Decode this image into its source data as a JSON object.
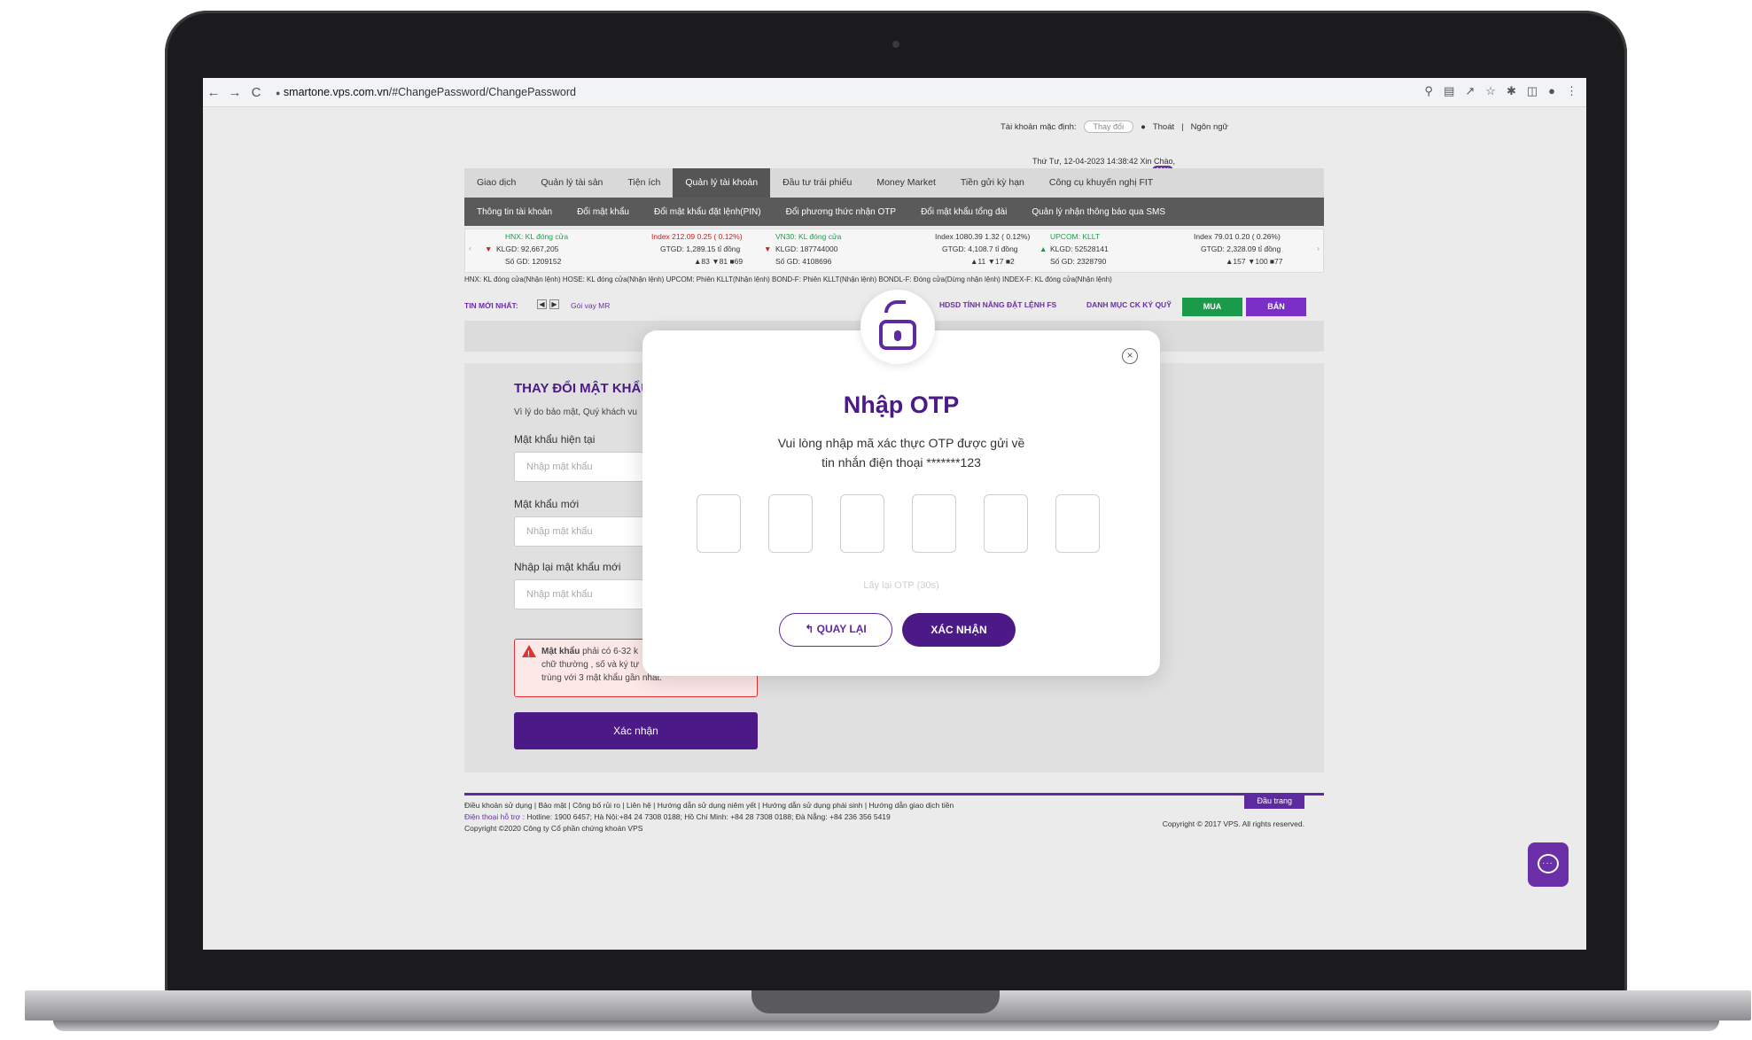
{
  "browser": {
    "url_host": "smartone.vps.com.vn",
    "url_path": "/#ChangePassword/ChangePassword",
    "back": "←",
    "forward": "→",
    "reload": "C",
    "lock": "🔒"
  },
  "header": {
    "default_account_label": "Tài khoản mặc định:",
    "change_label": "Thay đổi",
    "logout": "Thoát",
    "language": "Ngôn ngữ",
    "datetime": "Thứ Tư, 12-04-2023 14:38:42",
    "greeting": "Xin Chào,",
    "new_badge": "Mới"
  },
  "main_nav": [
    "Giao dịch",
    "Quản lý tài sản",
    "Tiện ích",
    "Quản lý tài khoản",
    "Đầu tư trái phiếu",
    "Money Market",
    "Tiền gửi kỳ hạn",
    "Công cụ khuyến nghị FIT"
  ],
  "main_nav_active": "Quản lý tài khoản",
  "sub_nav": [
    "Thông tin tài khoản",
    "Đổi mật khẩu",
    "Đổi mật khẩu đặt lệnh(PIN)",
    "Đổi phương thức nhận OTP",
    "Đổi mật khẩu tổng đài",
    "Quản lý nhận thông báo qua SMS"
  ],
  "ticker": {
    "hnx_title": "HNX: KL đóng cửa",
    "hnx_index": "Index 212.09  0.25 ( 0.12%)",
    "hnx_klgd": "KLGD:  92,667,205",
    "hnx_gtgd": "GTGD:  1,289.15 tỉ đồng",
    "hnx_sogd": "Số GD:  1209152",
    "hnx_breadth": "▲83 ▼81 ■69",
    "vn30_title": "VN30: KL đóng cửa",
    "vn30_index": "Index  1080.39  1.32 ( 0.12%)",
    "vn30_klgd": "KLGD:  187744000",
    "vn30_gtgd": "GTGD:  4,108.7 tỉ đồng",
    "vn30_sogd": "Số GD:  4108696",
    "vn30_breadth": "▲11 ▼17 ■2",
    "upcom_title": "UPCOM: KLLT",
    "upcom_index": "Index  79.01  0.20 ( 0.26%)",
    "upcom_klgd": "KLGD:  52528141",
    "upcom_gtgd": "GTGD:  2,328.09 tỉ đồng",
    "upcom_sogd": "Số GD:  2328790",
    "upcom_breadth": "▲157 ▼100 ■77"
  },
  "status_line": "HNX: KL đóng cửa(Nhận lệnh)   HOSE: KL đóng cửa(Nhận lệnh)   UPCOM: Phiên KLLT(Nhận lệnh)   BOND-F: Phiên KLLT(Nhận lệnh)   BONDL-F: Đóng cửa(Dừng nhận lệnh)   INDEX-F: KL đóng cửa(Nhận lệnh)",
  "news": {
    "label": "TIN MỚI NHẤT:",
    "link": "Gói vay MR",
    "promo": "HDSD TÍNH NĂNG ĐẶT LỆNH FS",
    "portfolio": "DANH MỤC CK KÝ QUỸ",
    "buy": "MUA",
    "sell": "BÁN"
  },
  "password_form": {
    "title": "THAY ĐỔI MẬT KHẨU Đ",
    "desc": "Vì lý do bảo mật, Quý khách vu",
    "current_label": "Mật khẩu hiện tại",
    "current_placeholder": "Nhập mật khẩu",
    "new_label": "Mật khẩu mới",
    "new_placeholder": "Nhập mật khẩu",
    "repeat_label": "Nhập lại mật khẩu mới",
    "repeat_placeholder": "Nhập mật khẩu",
    "warning_bold": "Mật khẩu",
    "warning_line1": " phải có 6-32 k",
    "warning_line2": "chữ thường , số và ký tự",
    "warning_line3": "trùng với 3 mật khẩu gần nhất.",
    "submit": "Xác nhận"
  },
  "footer": {
    "links": "Điều khoản sử dụng  |  Bảo mật  |  Công bố rủi ro  |  Liên hệ  |  Hướng dẫn sử dụng niêm yết  |  Hướng dẫn sử dụng phái sinh  |  Hướng dẫn giao dịch tiền",
    "hotline_label": "Điện thoại hỗ trợ :",
    "hotline": " Hotline: 1900 6457; Hà Nội:+84 24 7308 0188; Hồ Chí Minh: +84 28 7308 0188; Đà Nẵng: +84 236 356 5419",
    "copyright_left": "Copyright ©2020 Công ty Cổ phần chứng khoán VPS",
    "copyright_right": "Copyright © 2017 VPS. All rights reserved.",
    "top_button": "Đầu trang"
  },
  "otp_modal": {
    "title": "Nhập OTP",
    "desc_line1": "Vui lòng nhập mã xác thực OTP được gửi về",
    "desc_line2": "tin nhắn điện thoại *******123",
    "resend": "Lấy lại OTP (30s)",
    "back_button": "↰  QUAY LẠI",
    "confirm_button": "XÁC NHẬN",
    "close": "×"
  }
}
